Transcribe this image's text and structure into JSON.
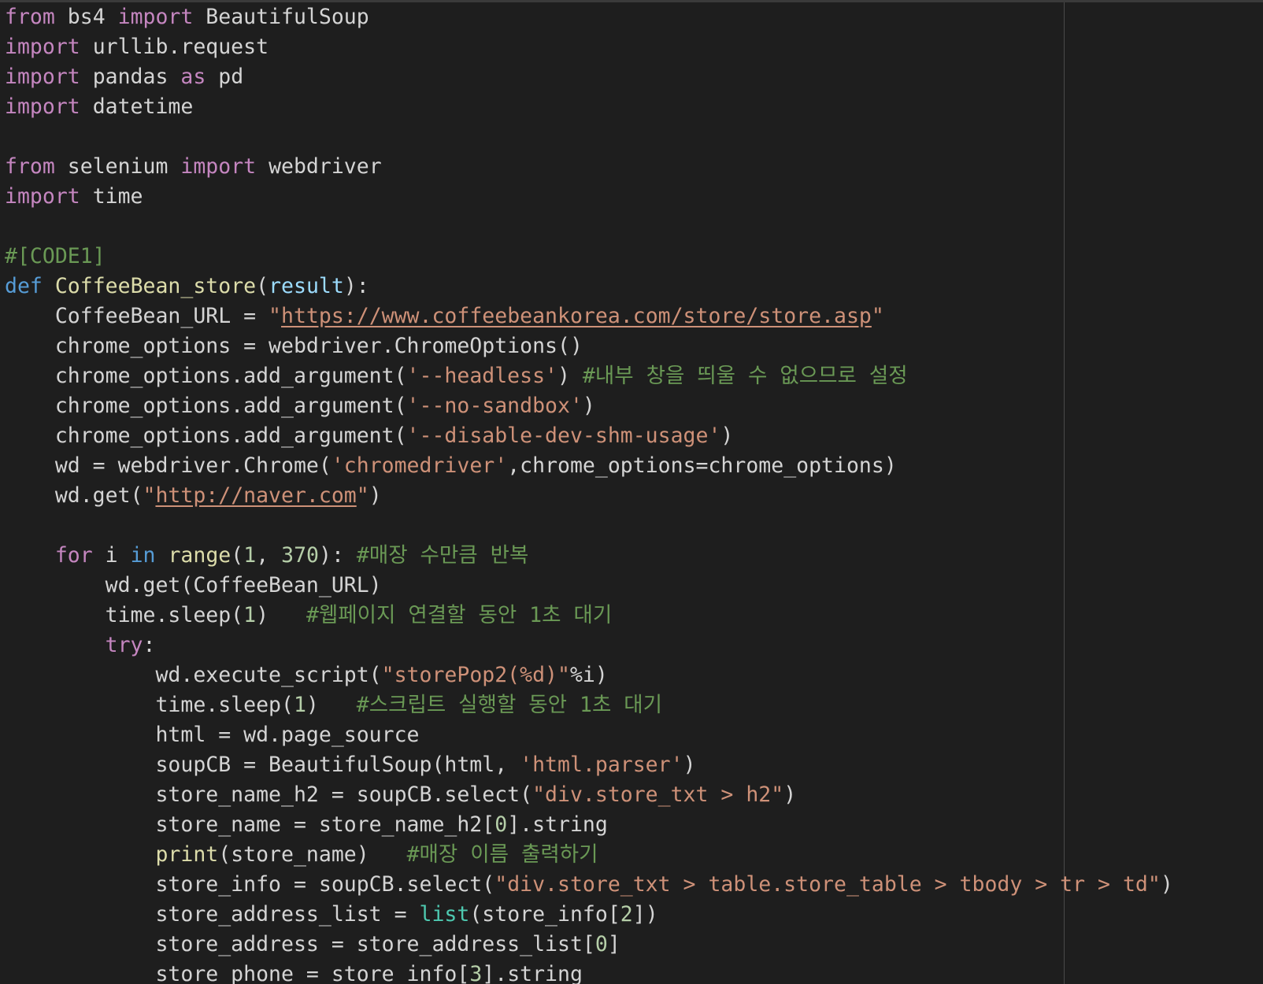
{
  "colors": {
    "background": "#1e1e1e",
    "keyword": "#c586c0",
    "def_keyword": "#569cd6",
    "function_name": "#dcdcaa",
    "parameter": "#9cdcfe",
    "string": "#ce9178",
    "number": "#b5cea8",
    "comment": "#6a9955",
    "builtin_class": "#4ec9b0",
    "plain": "#d4d4d4"
  },
  "editor": {
    "lines": [
      [
        {
          "t": "from",
          "c": "keyword"
        },
        {
          "t": " bs4 ",
          "c": "plain"
        },
        {
          "t": "import",
          "c": "keyword"
        },
        {
          "t": " BeautifulSoup",
          "c": "plain"
        }
      ],
      [
        {
          "t": "import",
          "c": "keyword"
        },
        {
          "t": " urllib.request",
          "c": "plain"
        }
      ],
      [
        {
          "t": "import",
          "c": "keyword"
        },
        {
          "t": " pandas ",
          "c": "plain"
        },
        {
          "t": "as",
          "c": "keyword"
        },
        {
          "t": " pd",
          "c": "plain"
        }
      ],
      [
        {
          "t": "import",
          "c": "keyword"
        },
        {
          "t": " datetime",
          "c": "plain"
        }
      ],
      [],
      [
        {
          "t": "from",
          "c": "keyword"
        },
        {
          "t": " selenium ",
          "c": "plain"
        },
        {
          "t": "import",
          "c": "keyword"
        },
        {
          "t": " webdriver",
          "c": "plain"
        }
      ],
      [
        {
          "t": "import",
          "c": "keyword"
        },
        {
          "t": " time",
          "c": "plain"
        }
      ],
      [],
      [
        {
          "t": "#[CODE1]",
          "c": "comment"
        }
      ],
      [
        {
          "t": "def",
          "c": "def"
        },
        {
          "t": " ",
          "c": "plain"
        },
        {
          "t": "CoffeeBean_store",
          "c": "funcname"
        },
        {
          "t": "(",
          "c": "plain"
        },
        {
          "t": "result",
          "c": "param"
        },
        {
          "t": "):",
          "c": "plain"
        }
      ],
      [
        {
          "t": "    CoffeeBean_URL = ",
          "c": "plain"
        },
        {
          "t": "\"",
          "c": "string"
        },
        {
          "t": "https://www.coffeebeankorea.com/store/store.asp",
          "c": "url"
        },
        {
          "t": "\"",
          "c": "string"
        }
      ],
      [
        {
          "t": "    chrome_options = webdriver.ChromeOptions()",
          "c": "plain"
        }
      ],
      [
        {
          "t": "    chrome_options.add_argument(",
          "c": "plain"
        },
        {
          "t": "'--headless'",
          "c": "string"
        },
        {
          "t": ") ",
          "c": "plain"
        },
        {
          "t": "#내부 창을 띄울 수 없으므로 설정",
          "c": "comment"
        }
      ],
      [
        {
          "t": "    chrome_options.add_argument(",
          "c": "plain"
        },
        {
          "t": "'--no-sandbox'",
          "c": "string"
        },
        {
          "t": ")",
          "c": "plain"
        }
      ],
      [
        {
          "t": "    chrome_options.add_argument(",
          "c": "plain"
        },
        {
          "t": "'--disable-dev-shm-usage'",
          "c": "string"
        },
        {
          "t": ")",
          "c": "plain"
        }
      ],
      [
        {
          "t": "    wd = webdriver.Chrome(",
          "c": "plain"
        },
        {
          "t": "'chromedriver'",
          "c": "string"
        },
        {
          "t": ",chrome_options=chrome_options)",
          "c": "plain"
        }
      ],
      [
        {
          "t": "    wd.get(",
          "c": "plain"
        },
        {
          "t": "\"",
          "c": "string"
        },
        {
          "t": "http://naver.com",
          "c": "url"
        },
        {
          "t": "\"",
          "c": "string"
        },
        {
          "t": ")",
          "c": "plain"
        }
      ],
      [],
      [
        {
          "t": "    ",
          "c": "plain"
        },
        {
          "t": "for",
          "c": "keyword"
        },
        {
          "t": " i ",
          "c": "plain"
        },
        {
          "t": "in",
          "c": "in"
        },
        {
          "t": " ",
          "c": "plain"
        },
        {
          "t": "range",
          "c": "builtin"
        },
        {
          "t": "(",
          "c": "plain"
        },
        {
          "t": "1",
          "c": "number"
        },
        {
          "t": ", ",
          "c": "plain"
        },
        {
          "t": "370",
          "c": "number"
        },
        {
          "t": "): ",
          "c": "plain"
        },
        {
          "t": "#매장 수만큼 반복",
          "c": "comment"
        }
      ],
      [
        {
          "t": "        wd.get(CoffeeBean_URL)",
          "c": "plain"
        }
      ],
      [
        {
          "t": "        time.sleep(",
          "c": "plain"
        },
        {
          "t": "1",
          "c": "number"
        },
        {
          "t": ")   ",
          "c": "plain"
        },
        {
          "t": "#웹페이지 연결할 동안 1초 대기",
          "c": "comment"
        }
      ],
      [
        {
          "t": "        ",
          "c": "plain"
        },
        {
          "t": "try",
          "c": "keyword"
        },
        {
          "t": ":",
          "c": "plain"
        }
      ],
      [
        {
          "t": "            wd.execute_script(",
          "c": "plain"
        },
        {
          "t": "\"storePop2(%d)\"",
          "c": "string"
        },
        {
          "t": "%i)",
          "c": "plain"
        }
      ],
      [
        {
          "t": "            time.sleep(",
          "c": "plain"
        },
        {
          "t": "1",
          "c": "number"
        },
        {
          "t": ")   ",
          "c": "plain"
        },
        {
          "t": "#스크립트 실행할 동안 1초 대기",
          "c": "comment"
        }
      ],
      [
        {
          "t": "            html = wd.page_source",
          "c": "plain"
        }
      ],
      [
        {
          "t": "            soupCB = BeautifulSoup(html, ",
          "c": "plain"
        },
        {
          "t": "'html.parser'",
          "c": "string"
        },
        {
          "t": ")",
          "c": "plain"
        }
      ],
      [
        {
          "t": "            store_name_h2 = soupCB.select(",
          "c": "plain"
        },
        {
          "t": "\"div.store_txt > h2\"",
          "c": "string"
        },
        {
          "t": ")",
          "c": "plain"
        }
      ],
      [
        {
          "t": "            store_name = store_name_h2[",
          "c": "plain"
        },
        {
          "t": "0",
          "c": "number"
        },
        {
          "t": "].string",
          "c": "plain"
        }
      ],
      [
        {
          "t": "            ",
          "c": "plain"
        },
        {
          "t": "print",
          "c": "builtin"
        },
        {
          "t": "(store_name)   ",
          "c": "plain"
        },
        {
          "t": "#매장 이름 출력하기",
          "c": "comment"
        }
      ],
      [
        {
          "t": "            store_info = soupCB.select(",
          "c": "plain"
        },
        {
          "t": "\"div.store_txt > table.store_table > tbody > tr > td\"",
          "c": "string"
        },
        {
          "t": ")",
          "c": "plain"
        }
      ],
      [
        {
          "t": "            store_address_list = ",
          "c": "plain"
        },
        {
          "t": "list",
          "c": "class"
        },
        {
          "t": "(store_info[",
          "c": "plain"
        },
        {
          "t": "2",
          "c": "number"
        },
        {
          "t": "])",
          "c": "plain"
        }
      ],
      [
        {
          "t": "            store_address = store_address_list[",
          "c": "plain"
        },
        {
          "t": "0",
          "c": "number"
        },
        {
          "t": "]",
          "c": "plain"
        }
      ],
      [
        {
          "t": "            store_phone = store_info[",
          "c": "plain"
        },
        {
          "t": "3",
          "c": "number"
        },
        {
          "t": "].string",
          "c": "plain"
        }
      ]
    ]
  }
}
